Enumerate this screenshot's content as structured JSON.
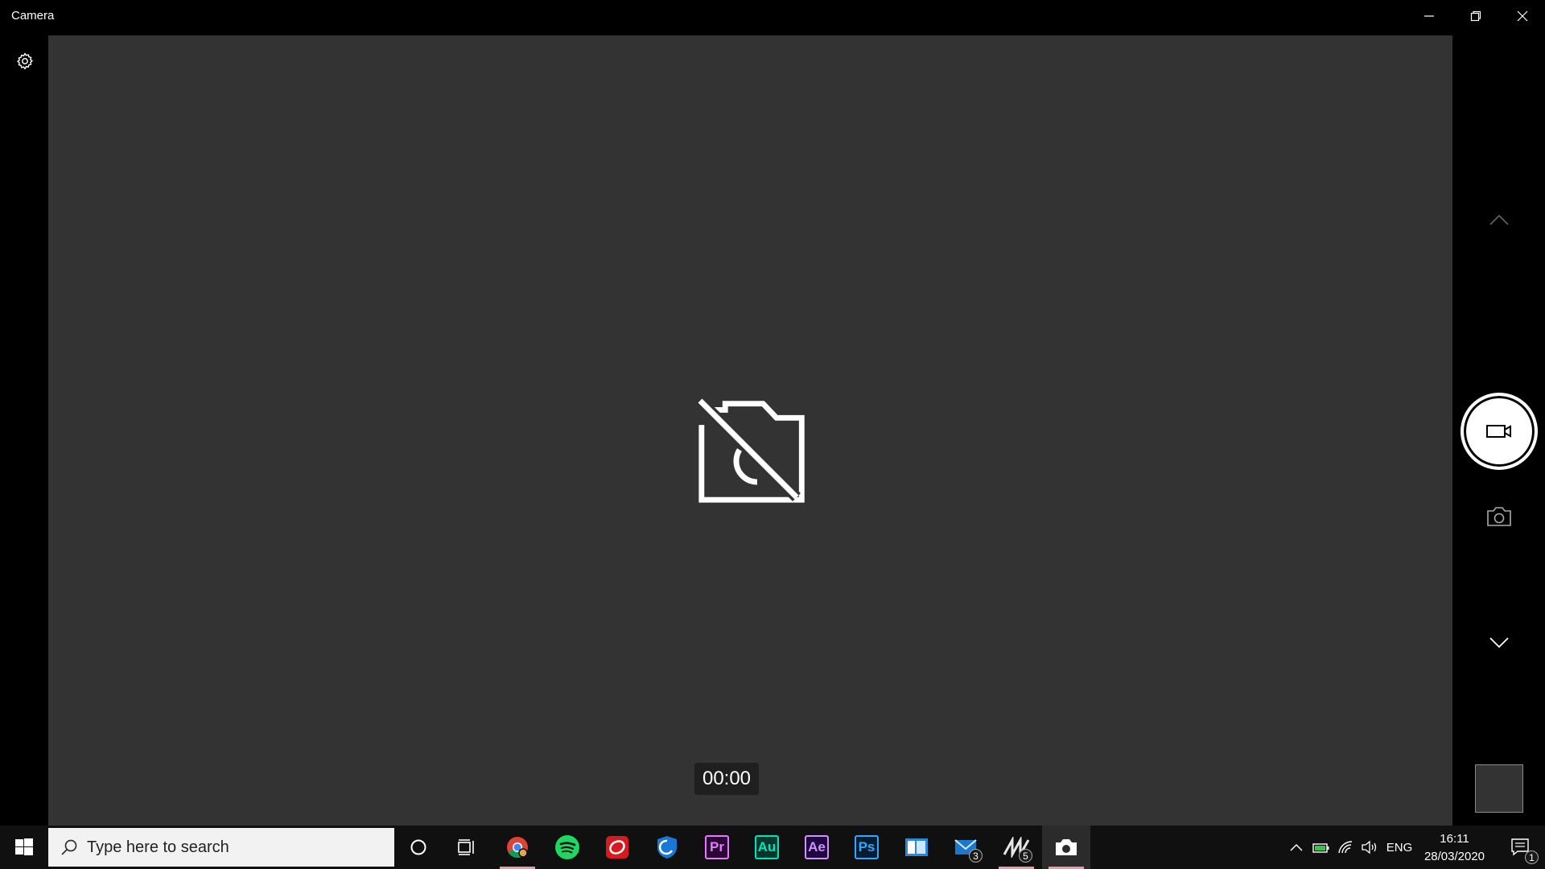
{
  "window": {
    "title": "Camera",
    "controls": {
      "minimize": "minimize-icon",
      "restore": "restore-icon",
      "close": "close-icon"
    }
  },
  "camera": {
    "status_icon": "camera-off-icon",
    "timer": "00:00"
  },
  "right_rail": {
    "buttons": [
      "chevron-up-icon",
      "video-record-icon",
      "photo-camera-icon",
      "chevron-down-icon"
    ]
  },
  "taskbar": {
    "search": {
      "placeholder": "Type here to search"
    },
    "apps": [
      {
        "name": "Chrome",
        "running": true
      },
      {
        "name": "Spotify"
      },
      {
        "name": "Trend Micro"
      },
      {
        "name": "Shield"
      },
      {
        "name": "Pr",
        "color": "#ea77ff",
        "bg": "#2a0634"
      },
      {
        "name": "Au",
        "color": "#00e4bb",
        "bg": "#00382d"
      },
      {
        "name": "Ae",
        "color": "#d291ff",
        "bg": "#1f0740"
      },
      {
        "name": "Ps",
        "color": "#31a8ff",
        "bg": "#001d34"
      },
      {
        "name": "Blue Window"
      },
      {
        "name": "Mail",
        "badge": "3"
      },
      {
        "name": "Zigzag",
        "badge": "5",
        "running": true
      },
      {
        "name": "Camera",
        "active": true,
        "running": true
      }
    ],
    "tray": {
      "language": "ENG",
      "time": "16:11",
      "date": "28/03/2020",
      "notifications": "1"
    }
  }
}
